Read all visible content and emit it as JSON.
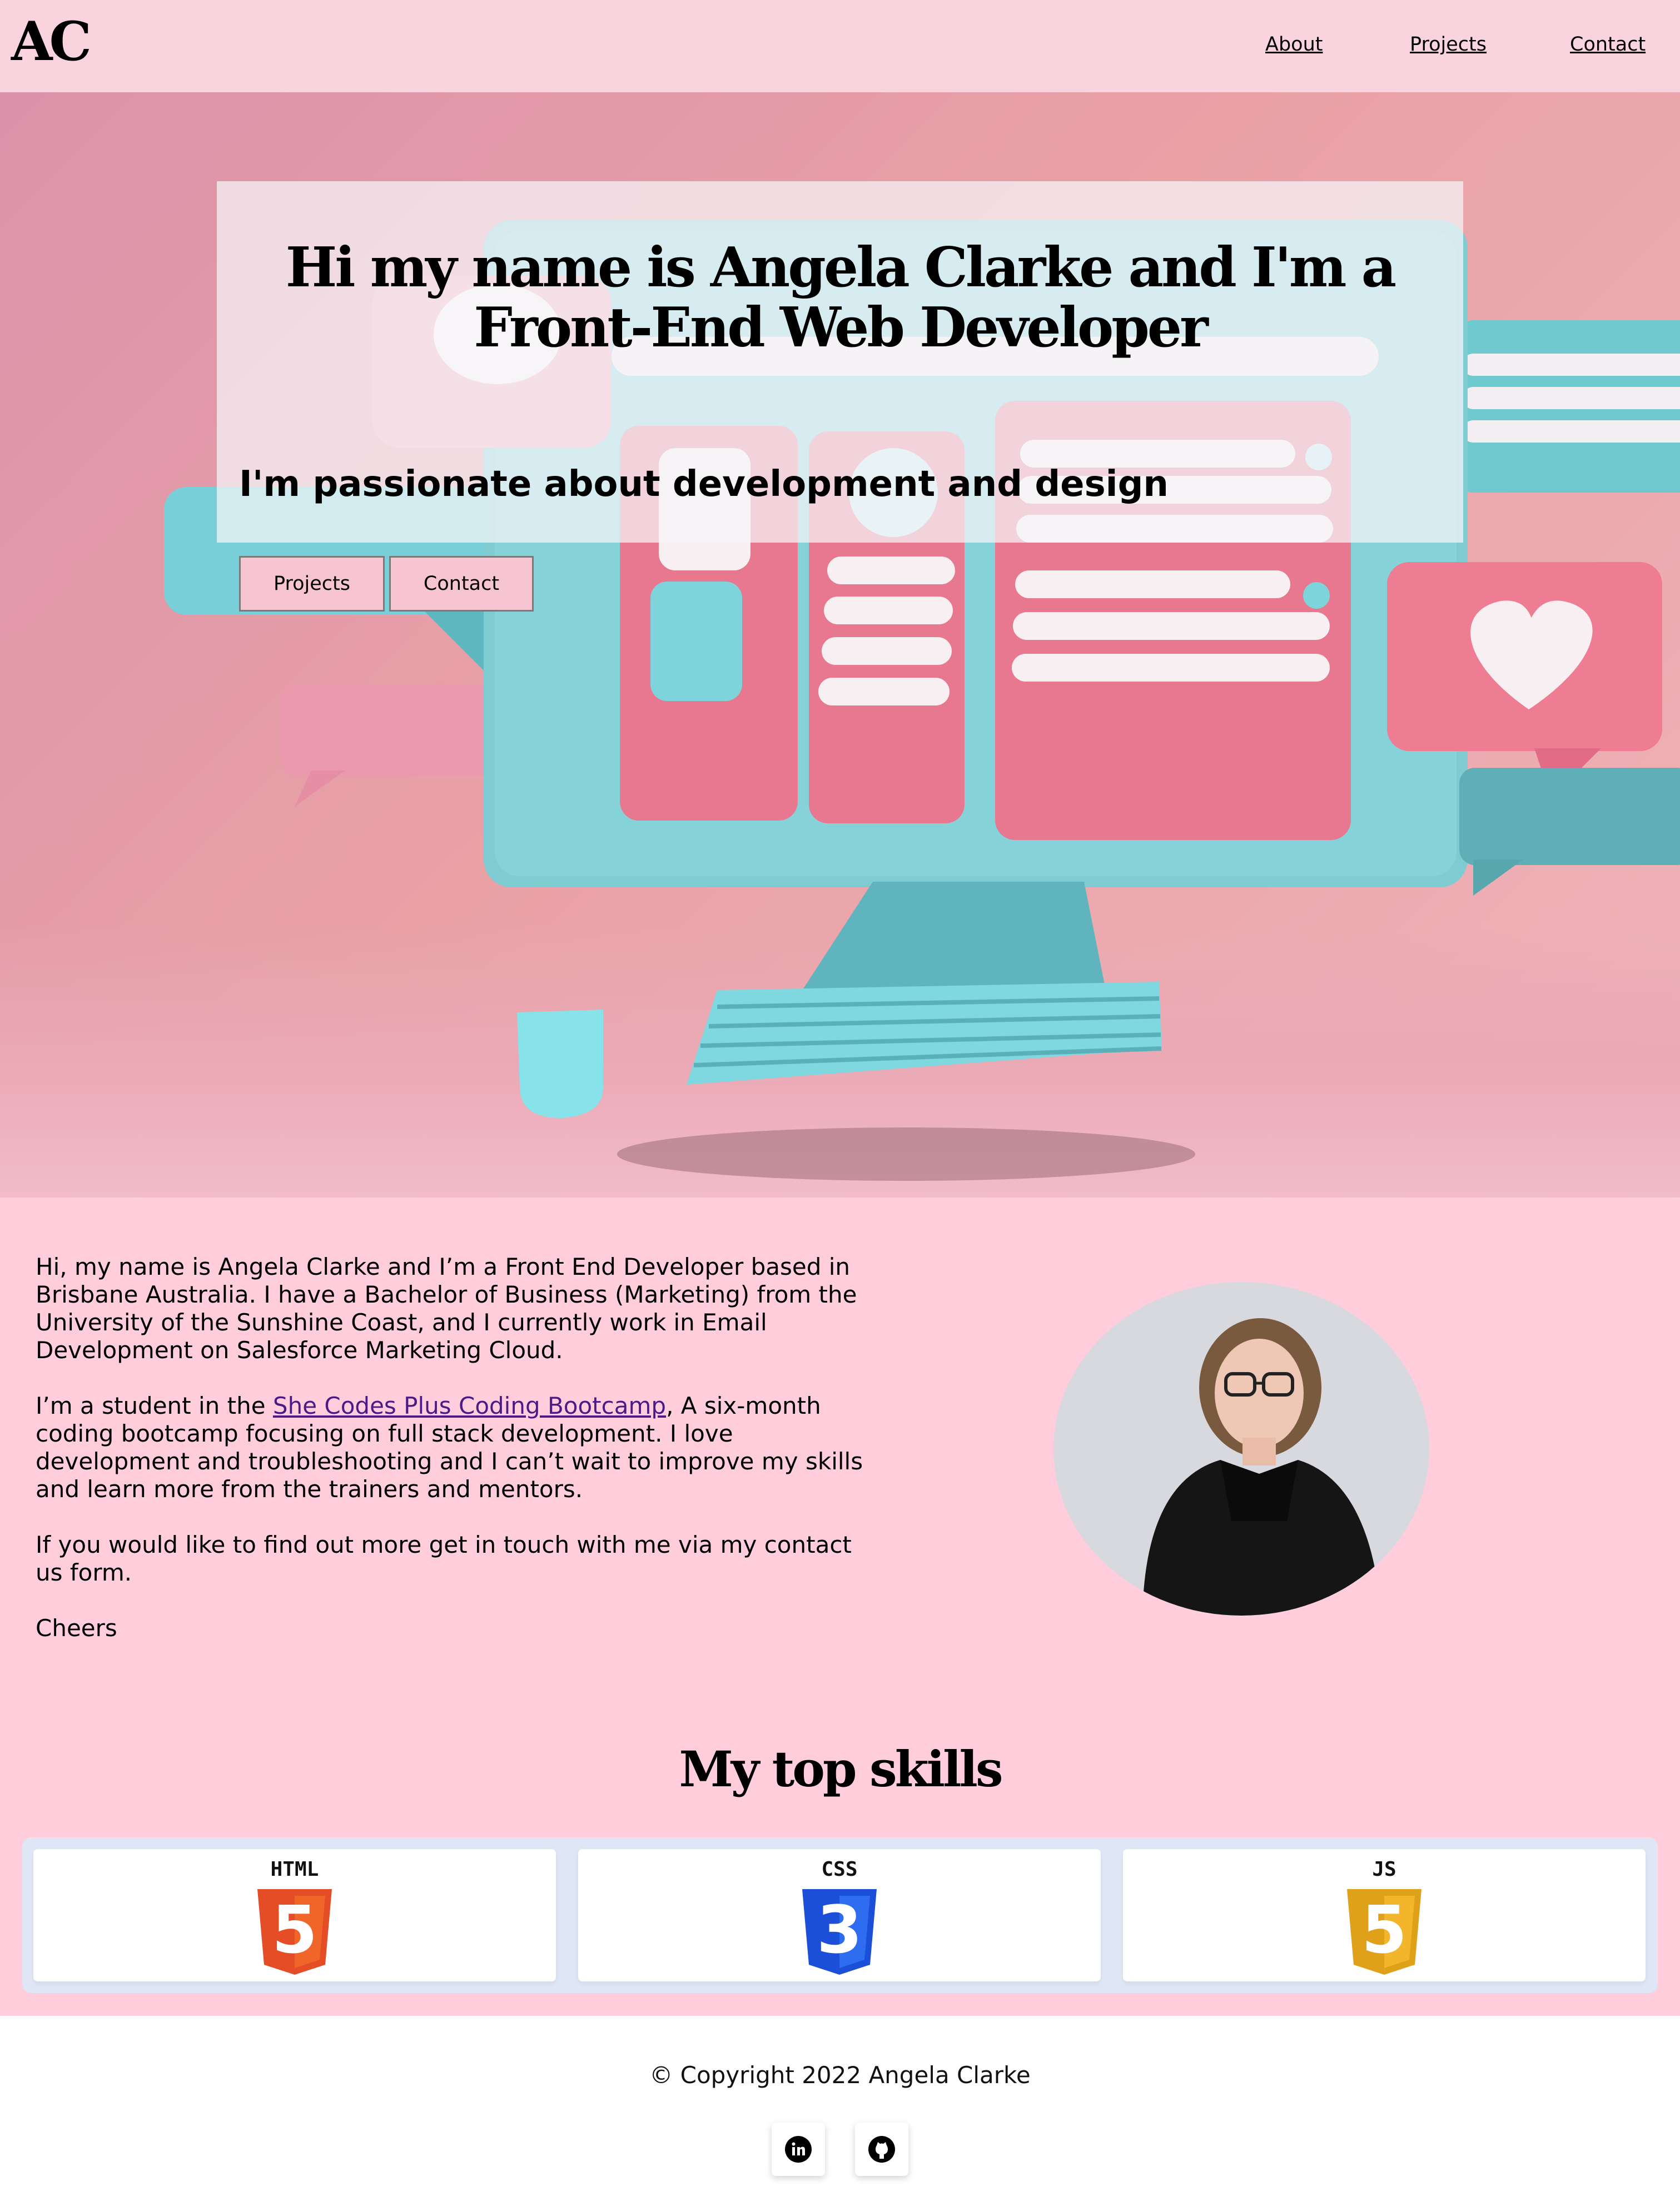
{
  "nav": {
    "logo": "AC",
    "links": [
      "About",
      "Projects",
      "Contact"
    ]
  },
  "hero": {
    "title": "Hi my name is Angela Clarke and I'm a Front-End Web Developer",
    "subtitle": "I'm passionate about development and design",
    "buttons": [
      "Projects",
      "Contact"
    ]
  },
  "about": {
    "p1": "Hi, my name is Angela Clarke and I’m a Front End Developer based in Brisbane Australia. I have a Bachelor of Business (Marketing) from the University of the Sunshine Coast, and I currently work in Email Development on Salesforce Marketing Cloud.",
    "p2_before": "I’m a student in the ",
    "p2_link": "She Codes Plus Coding Bootcamp",
    "p2_after": ", A six-month coding bootcamp focusing on full stack development. I love development and troubleshooting and I can’t wait to improve my skills and learn more from the trainers and mentors.",
    "p3": "If you would like to find out more get in touch with me via my contact us form.",
    "p4": "Cheers"
  },
  "skills": {
    "title": "My top skills",
    "items": [
      {
        "label": "HTML",
        "digit": "5",
        "color": "#e44d26",
        "shade": "#f16529",
        "icon": "html5-icon"
      },
      {
        "label": "CSS",
        "digit": "3",
        "color": "#1b4fd8",
        "shade": "#2f6df0",
        "icon": "css3-icon"
      },
      {
        "label": "JS",
        "digit": "5",
        "color": "#e0a11a",
        "shade": "#f3b52a",
        "icon": "js-icon"
      }
    ]
  },
  "footer": {
    "copyright": "© Copyright 2022 Angela Clarke",
    "social": [
      "linkedin-icon",
      "github-icon"
    ]
  },
  "colors": {
    "nav_bg": "#f9d3de",
    "page_bg": "#ffcddb",
    "button_bg": "#f7c4d2",
    "link_purple": "#4b1a87"
  }
}
